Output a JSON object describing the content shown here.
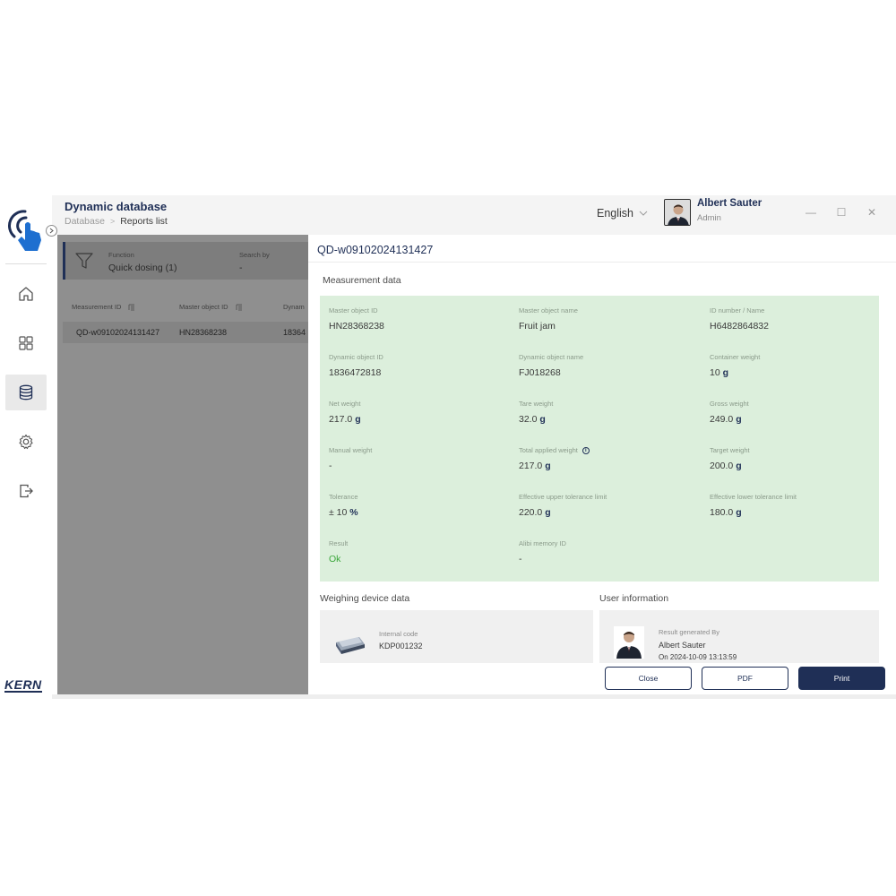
{
  "header": {
    "title": "Dynamic database",
    "breadcrumb": {
      "root": "Database",
      "separator": ">",
      "current": "Reports list"
    },
    "language": "English",
    "user": {
      "name": "Albert Sauter",
      "role": "Admin"
    },
    "window": {
      "minimize": "—",
      "maximize": "☐",
      "close": "✕"
    }
  },
  "sidebar": {
    "brand": "KERN",
    "items": [
      {
        "name": "home",
        "icon": "home-icon"
      },
      {
        "name": "dashboard",
        "icon": "grid-icon"
      },
      {
        "name": "database",
        "icon": "database-icon",
        "active": true
      },
      {
        "name": "settings",
        "icon": "gear-icon"
      },
      {
        "name": "logout",
        "icon": "logout-icon"
      }
    ]
  },
  "list": {
    "filter": {
      "label": "Function",
      "value": "Quick dosing (1)"
    },
    "search": {
      "label": "Search by",
      "value": "-"
    },
    "columns": [
      "Measurement ID",
      "Master object ID",
      "Dynam"
    ],
    "rows": [
      {
        "measurement_id": "QD-w09102024131427",
        "master_object_id": "HN28368238",
        "dynamic": "18364"
      }
    ]
  },
  "detail": {
    "title": "QD-w09102024131427",
    "measurement_title": "Measurement data",
    "fields": {
      "master_object_id": {
        "label": "Master object ID",
        "value": "HN28368238"
      },
      "master_object_name": {
        "label": "Master object name",
        "value": "Fruit jam"
      },
      "id_number": {
        "label": "ID number / Name",
        "value": "H6482864832"
      },
      "dynamic_object_id": {
        "label": "Dynamic object ID",
        "value": "1836472818"
      },
      "dynamic_object_name": {
        "label": "Dynamic object name",
        "value": "FJ018268"
      },
      "container_weight": {
        "label": "Container weight",
        "value": "10",
        "unit": "g"
      },
      "net_weight": {
        "label": "Net weight",
        "value": "217.0",
        "unit": "g"
      },
      "tare_weight": {
        "label": "Tare weight",
        "value": "32.0",
        "unit": "g"
      },
      "gross_weight": {
        "label": "Gross weight",
        "value": "249.0",
        "unit": "g"
      },
      "manual_weight": {
        "label": "Manual weight",
        "value": "-"
      },
      "total_applied_weight": {
        "label": "Total applied weight",
        "value": "217.0",
        "unit": "g",
        "info": "i"
      },
      "target_weight": {
        "label": "Target weight",
        "value": "200.0",
        "unit": "g"
      },
      "tolerance": {
        "label": "Tolerance",
        "value": "± 10",
        "unit": "%"
      },
      "upper_tolerance": {
        "label": "Effective upper tolerance limit",
        "value": "220.0",
        "unit": "g"
      },
      "lower_tolerance": {
        "label": "Effective lower tolerance limit",
        "value": "180.0",
        "unit": "g"
      },
      "result": {
        "label": "Result",
        "value": "Ok"
      },
      "alibi_memory_id": {
        "label": "Alibi memory ID",
        "value": "-"
      }
    },
    "weighing": {
      "title": "Weighing device data",
      "internal_code_label": "Internal code",
      "internal_code": "KDP001232"
    },
    "user_info": {
      "title": "User information",
      "generated_label": "Result generated By",
      "name": "Albert Sauter",
      "date": "On 2024-10-09 13:13:59"
    },
    "buttons": {
      "close": "Close",
      "pdf": "PDF",
      "print": "Print"
    }
  },
  "colors": {
    "brand_navy": "#1f2f56",
    "measurement_bg": "#dcefdc",
    "result_ok": "#3aa63a",
    "overlay": "#8f8f8f"
  }
}
